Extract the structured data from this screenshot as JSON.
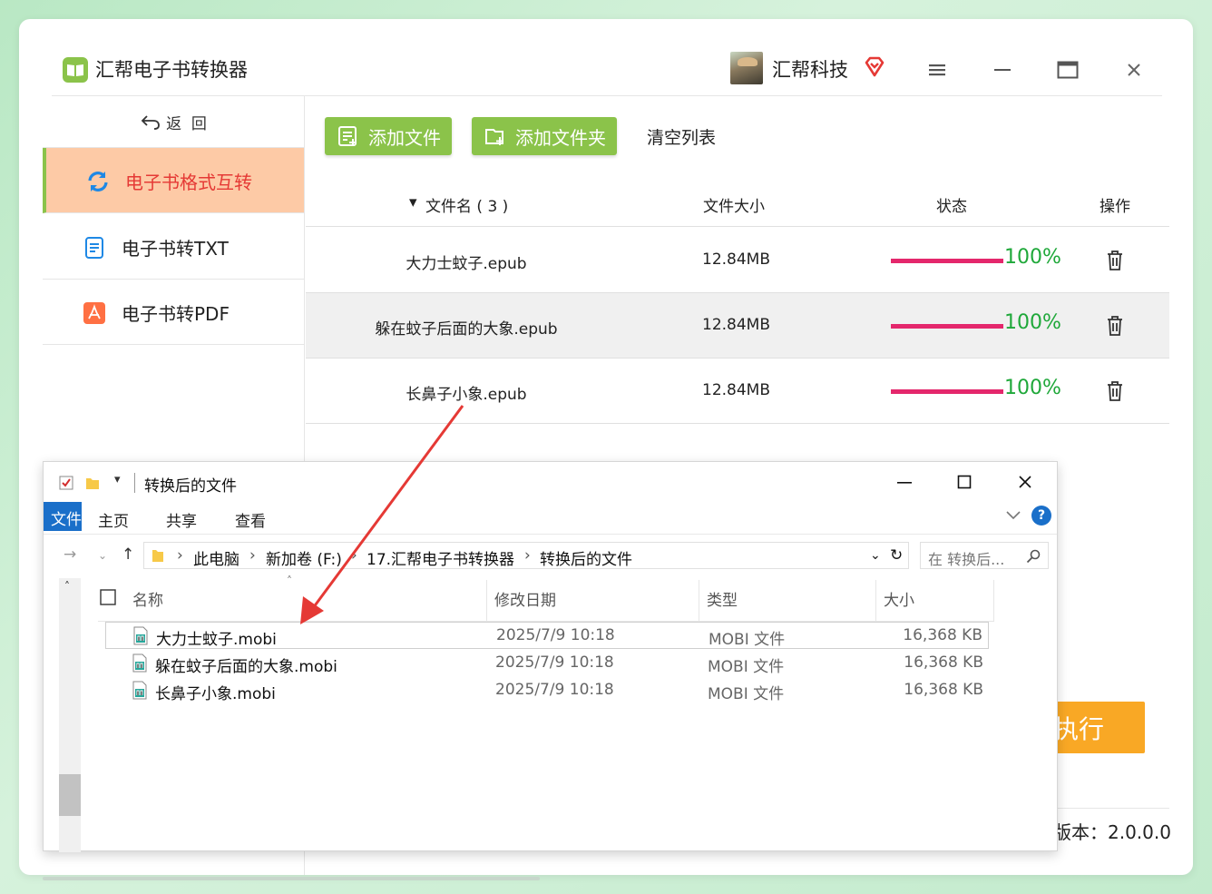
{
  "app": {
    "title": "汇帮电子书转换器",
    "user_name": "汇帮科技",
    "back_label": "返  回",
    "nav": [
      {
        "label": "电子书格式互转",
        "active": true
      },
      {
        "label": "电子书转TXT",
        "active": false
      },
      {
        "label": "电子书转PDF",
        "active": false
      }
    ],
    "toolbar": {
      "add_file": "添加文件",
      "add_folder": "添加文件夹",
      "clear_list": "清空列表"
    },
    "table": {
      "headers": {
        "name": "文件名 ( 3 )",
        "size": "文件大小",
        "status": "状态",
        "action": "操作"
      },
      "rows": [
        {
          "name": "大力士蚊子.epub",
          "size": "12.84MB",
          "progress": 100,
          "progress_label": "100%"
        },
        {
          "name": "躲在蚊子后面的大象.epub",
          "size": "12.84MB",
          "progress": 100,
          "progress_label": "100%"
        },
        {
          "name": "长鼻子小象.epub",
          "size": "12.84MB",
          "progress": 100,
          "progress_label": "100%"
        }
      ]
    },
    "execute_label": "执行",
    "version_label": "版本：2.0.0.0",
    "colors": {
      "accent_green": "#8bc34a",
      "active_bg": "#fdcaa6",
      "active_text": "#e53935",
      "progress": "#e4276c",
      "pct_text": "#1fa83a",
      "execute": "#f9a825"
    }
  },
  "explorer": {
    "title": "转换后的文件",
    "ribbon": {
      "file": "文件",
      "home": "主页",
      "share": "共享",
      "view": "查看"
    },
    "breadcrumb": [
      "此电脑",
      "新加卷 (F:)",
      "17.汇帮电子书转换器",
      "转换后的文件"
    ],
    "search_placeholder": "在 转换后...",
    "columns": {
      "name": "名称",
      "date": "修改日期",
      "type": "类型",
      "size": "大小"
    },
    "files": [
      {
        "name": "大力士蚊子.mobi",
        "date": "2025/7/9 10:18",
        "type": "MOBI 文件",
        "size": "16,368 KB",
        "selected": true
      },
      {
        "name": "躲在蚊子后面的大象.mobi",
        "date": "2025/7/9 10:18",
        "type": "MOBI 文件",
        "size": "16,368 KB",
        "selected": false
      },
      {
        "name": "长鼻子小象.mobi",
        "date": "2025/7/9 10:18",
        "type": "MOBI 文件",
        "size": "16,368 KB",
        "selected": false
      }
    ]
  }
}
